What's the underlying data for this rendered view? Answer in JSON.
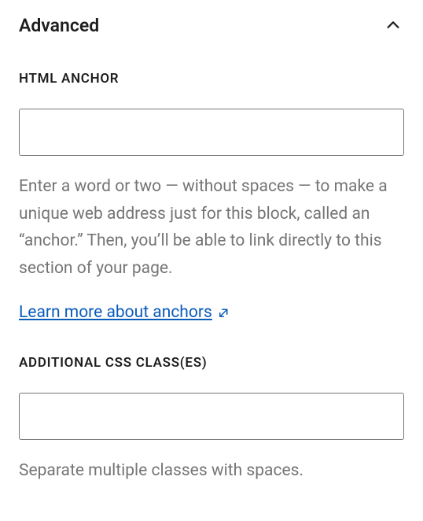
{
  "panel": {
    "title": "Advanced"
  },
  "fields": {
    "anchor": {
      "label": "HTML ANCHOR",
      "value": "",
      "help": "Enter a word or two — without spaces — to make a unique web address just for this block, called an “anchor.” Then, you’ll be able to link directly to this section of your page.",
      "link_text": "Learn more about anchors"
    },
    "css": {
      "label": "ADDITIONAL CSS CLASS(ES)",
      "value": "",
      "help": "Separate multiple classes with spaces."
    }
  }
}
